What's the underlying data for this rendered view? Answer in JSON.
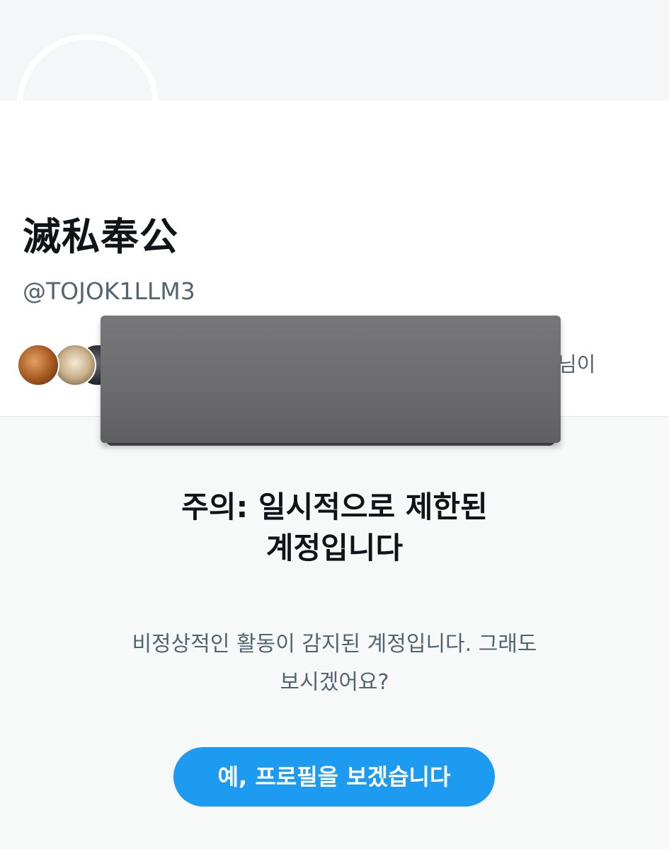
{
  "profile": {
    "display_name": "滅私奉公",
    "handle": "@TOJOK1LLM3",
    "followers_suffix": "님이"
  },
  "warning": {
    "title_line1": "주의: 일시적으로 제한된",
    "title_line2": "계정입니다",
    "body_line1": "비정상적인 활동이 감지된 계정입니다. 그래도",
    "body_line2": "보시겠어요?",
    "button_label": "예, 프로필을 보겠습니다"
  },
  "colors": {
    "accent": "#1d9bf0",
    "redaction": "#6b6b6d"
  }
}
